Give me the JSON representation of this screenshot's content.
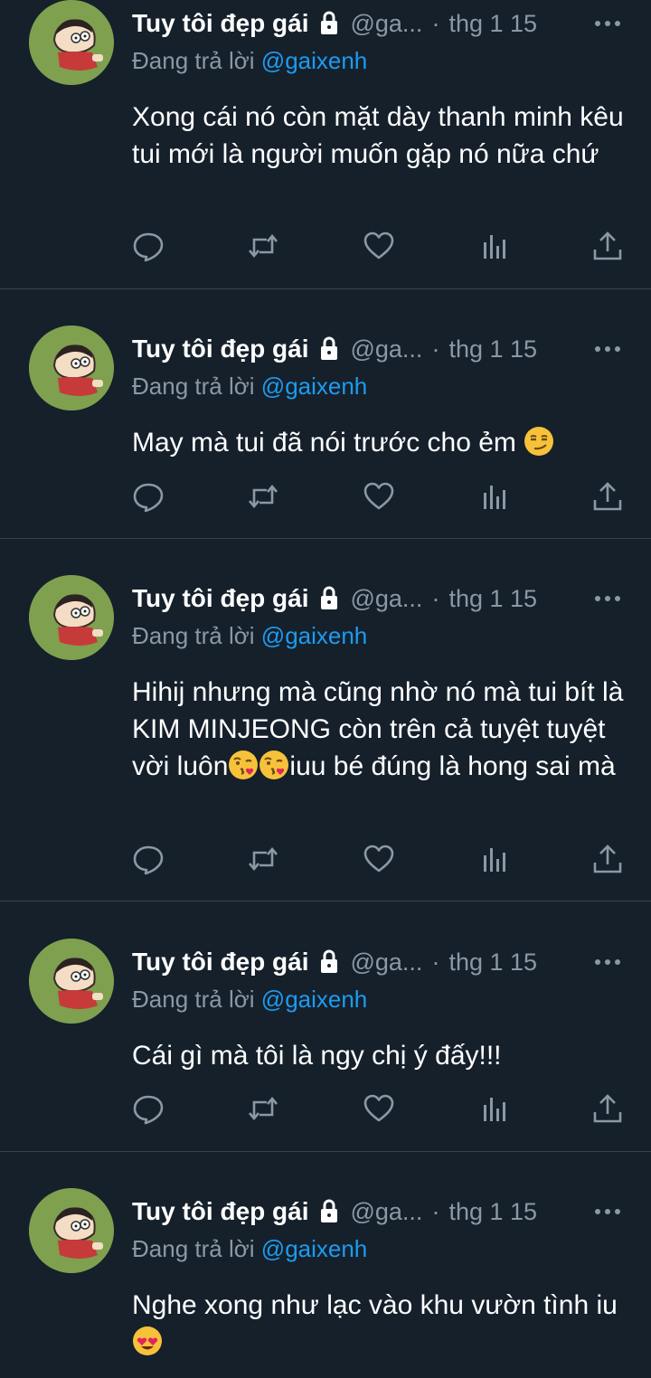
{
  "colors": {
    "background": "#15202b",
    "text": "#ffffff",
    "muted": "#8b98a5",
    "link": "#1d9bf0",
    "divider": "#38444d"
  },
  "tweets": [
    {
      "display_name": "Tuy tôi đẹp gái",
      "handle": "@ga...",
      "separator": "·",
      "timestamp": "thg 1 15",
      "reply_prefix": "Đang trả lời",
      "reply_handle": "@gaixenh",
      "text_parts": [
        "Xong cái nó còn mặt dày thanh minh kêu tui mới là người muốn gặp nó nữa chứ"
      ],
      "icons": [
        "lock-icon",
        "more-icon",
        "reply-icon",
        "retweet-icon",
        "like-icon",
        "analytics-icon",
        "share-icon"
      ]
    },
    {
      "display_name": "Tuy tôi đẹp gái",
      "handle": "@ga...",
      "separator": "·",
      "timestamp": "thg 1 15",
      "reply_prefix": "Đang trả lời",
      "reply_handle": "@gaixenh",
      "text_parts": [
        "May mà tui đã nói trước cho ẻm "
      ],
      "emoji": "smirk-emoji"
    },
    {
      "display_name": "Tuy tôi đẹp gái",
      "handle": "@ga...",
      "separator": "·",
      "timestamp": "thg 1 15",
      "reply_prefix": "Đang trả lời",
      "reply_handle": "@gaixenh",
      "text_parts": [
        "Hihij nhưng mà cũng nhờ nó mà tui bít là KIM MINJEONG còn trên cả tuyệt tuyệt vời luôn",
        "iuu bé đúng là hong sai mà"
      ],
      "emoji": "kissing-heart-emoji"
    },
    {
      "display_name": "Tuy tôi đẹp gái",
      "handle": "@ga...",
      "separator": "·",
      "timestamp": "thg 1 15",
      "reply_prefix": "Đang trả lời",
      "reply_handle": "@gaixenh",
      "text_parts": [
        "Cái gì mà tôi là ngy chị ý đấy!!!"
      ]
    },
    {
      "display_name": "Tuy tôi đẹp gái",
      "handle": "@ga...",
      "separator": "·",
      "timestamp": "thg 1 15",
      "reply_prefix": "Đang trả lời",
      "reply_handle": "@gaixenh",
      "text_parts": [
        "Nghe xong như lạc vào khu vườn tình iu "
      ],
      "emoji": "heart-eyes-emoji"
    }
  ]
}
